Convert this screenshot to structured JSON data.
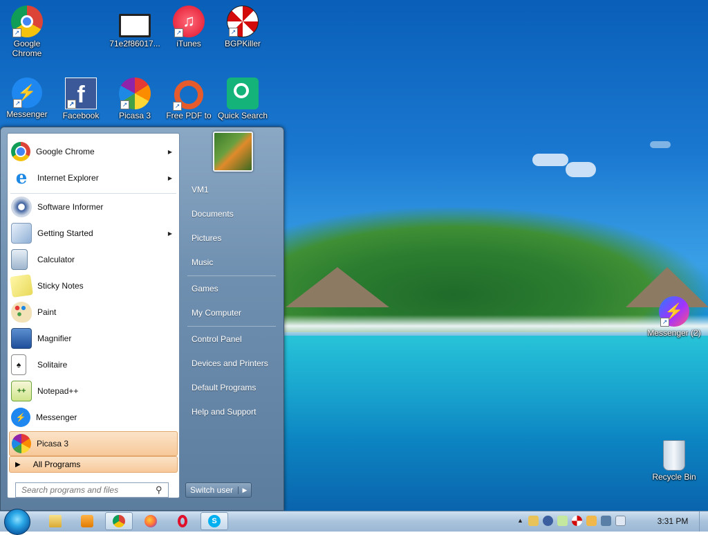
{
  "desktop": {
    "icons": [
      {
        "label": "Google\nChrome",
        "icon": "chrome-icon"
      },
      {
        "label": "71e2f86017...",
        "icon": "video-file-icon"
      },
      {
        "label": "iTunes",
        "icon": "itunes-icon"
      },
      {
        "label": "BGPKiller",
        "icon": "bgpkiller-icon"
      },
      {
        "label": "Messenger",
        "icon": "messenger-icon"
      },
      {
        "label": "Facebook",
        "icon": "facebook-icon"
      },
      {
        "label": "Picasa 3",
        "icon": "picasa-icon"
      },
      {
        "label": "Free PDF to",
        "icon": "pdf-converter-icon"
      },
      {
        "label": "Quick Search",
        "icon": "quick-search-icon"
      },
      {
        "label": "Messenger (2)",
        "icon": "messenger-icon"
      },
      {
        "label": "Recycle Bin",
        "icon": "recycle-bin-icon"
      }
    ]
  },
  "start_menu": {
    "programs": [
      {
        "label": "Google Chrome",
        "icon": "chrome-icon",
        "submenu": true
      },
      {
        "label": "Internet Explorer",
        "icon": "ie-icon",
        "submenu": true
      },
      {
        "label": "Software Informer",
        "icon": "software-informer-icon",
        "submenu": false
      },
      {
        "label": "Getting Started",
        "icon": "getting-started-icon",
        "submenu": true
      },
      {
        "label": "Calculator",
        "icon": "calculator-icon",
        "submenu": false
      },
      {
        "label": "Sticky Notes",
        "icon": "sticky-notes-icon",
        "submenu": false
      },
      {
        "label": "Paint",
        "icon": "paint-icon",
        "submenu": false
      },
      {
        "label": "Magnifier",
        "icon": "magnifier-icon",
        "submenu": false
      },
      {
        "label": "Solitaire",
        "icon": "solitaire-icon",
        "submenu": false
      },
      {
        "label": "Notepad++",
        "icon": "notepadpp-icon",
        "submenu": false
      },
      {
        "label": "Messenger",
        "icon": "messenger-icon",
        "submenu": false
      },
      {
        "label": "Picasa 3",
        "icon": "picasa-icon",
        "submenu": false
      }
    ],
    "all_programs": "All Programs",
    "search_placeholder": "Search programs and files",
    "right_items": [
      {
        "label": "VM1"
      },
      {
        "label": "Documents"
      },
      {
        "label": "Pictures"
      },
      {
        "label": "Music"
      },
      {
        "label": "Games"
      },
      {
        "label": "My Computer"
      },
      {
        "label": "Control Panel"
      },
      {
        "label": "Devices and Printers"
      },
      {
        "label": "Default Programs"
      },
      {
        "label": "Help and Support"
      }
    ],
    "switch_user": "Switch user"
  },
  "taskbar": {
    "clock": "3:31 PM",
    "pinned": [
      "explorer-icon",
      "media-player-icon",
      "chrome-icon",
      "firefox-icon",
      "opera-icon",
      "skype-icon"
    ]
  },
  "colors": {
    "highlight": "#f7c99a",
    "start_menu_right": "#6f8fb0",
    "taskbar": "#a9c3dc"
  }
}
